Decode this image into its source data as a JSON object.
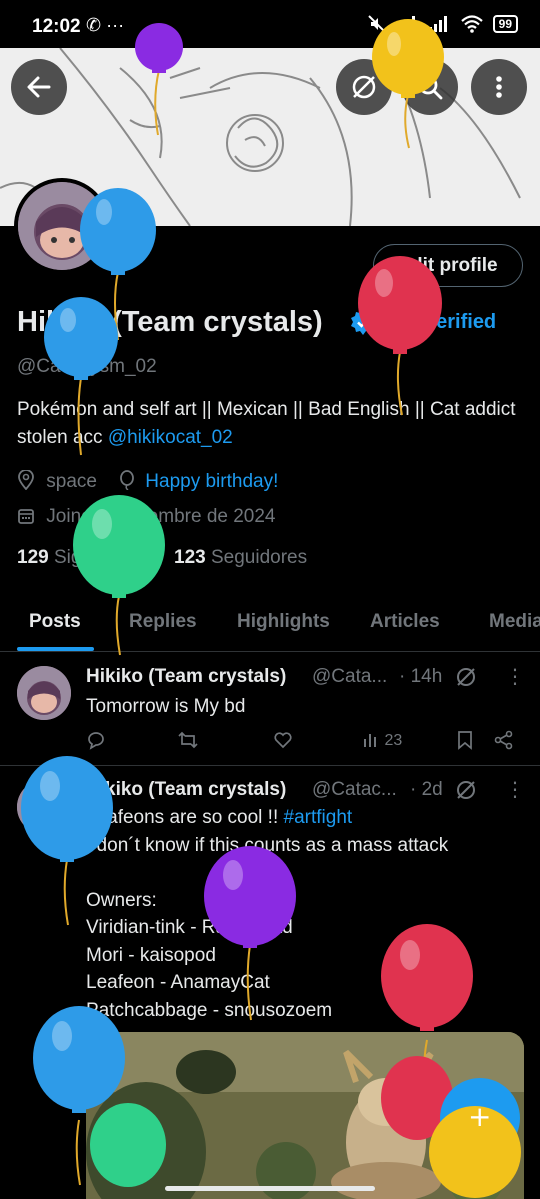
{
  "status_bar": {
    "time": "12:02",
    "notif_icons": "✆ ···",
    "battery": "99"
  },
  "header": {
    "back_icon": "arrow-left-icon",
    "menu_icon": "more-vertical-icon"
  },
  "profile": {
    "edit_label": "Edit profile",
    "name": "Hikiko (Team crystals)",
    "get_verified": "Get Verified",
    "handle": "@Cataclysm_02",
    "bio_text": "Pokémon and self art  ||  Mexican || Bad English || Cat addict  stolen acc ",
    "bio_link": "@hikikocat_02",
    "location": "space",
    "birthday": "Happy birthday!",
    "joined": "Joined septiembre de 2024",
    "following_count": "129",
    "following_label": "Siguiendo",
    "followers_count": "123",
    "followers_label": "Seguidores"
  },
  "tabs": [
    {
      "label": "Posts"
    },
    {
      "label": "Replies"
    },
    {
      "label": "Highlights"
    },
    {
      "label": "Articles"
    },
    {
      "label": "Media"
    }
  ],
  "tweets": [
    {
      "name": "Hikiko (Team crystals)",
      "handle": "@Cata...",
      "time": "· 14h",
      "text": "Tomorrow is My bd",
      "views": "23"
    },
    {
      "name": "Hikiko (Team crystals)",
      "handle": "@Catac...",
      "time": "· 2d",
      "text_before_tag": "Leafeons are so cool !! ",
      "hashtag": "#artfight",
      "text_rest": "I don´t know if this counts as a mass attack\n\nOwners:\nViridian-tink - RanoRoad\nMori - kaisopod\nLeafeon - AnamayCat\nPatchcabbage - snousozoem"
    }
  ],
  "colors": {
    "accent": "#1d9bf0",
    "background": "#000000",
    "text": "#e7e9ea",
    "muted": "#71767b",
    "balloon_blue": "#2e9be8",
    "balloon_red": "#e0334f",
    "balloon_green": "#2fd08a",
    "balloon_purple": "#8a2be2",
    "balloon_yellow": "#f2c21b"
  }
}
